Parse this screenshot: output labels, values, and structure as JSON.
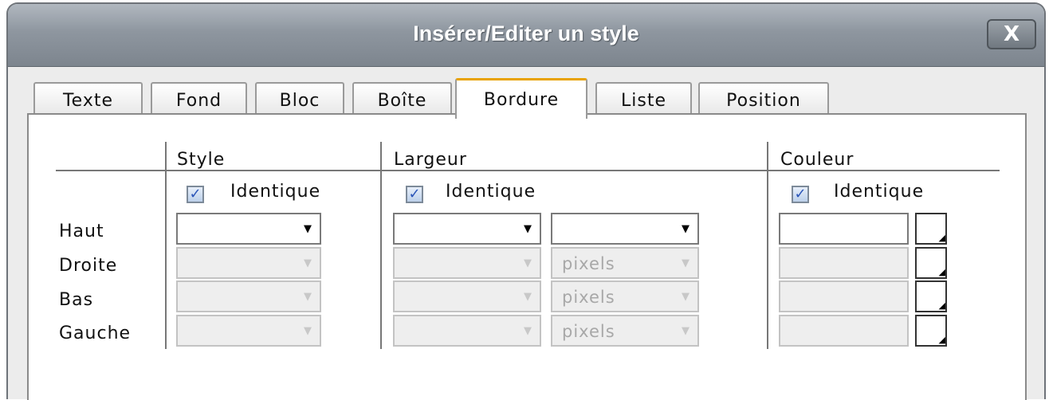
{
  "window": {
    "title": "Insérer/Editer un style",
    "close_label": "X"
  },
  "tabs": [
    {
      "label": "Texte"
    },
    {
      "label": "Fond"
    },
    {
      "label": "Bloc"
    },
    {
      "label": "Boîte"
    },
    {
      "label": "Bordure",
      "active": true
    },
    {
      "label": "Liste"
    },
    {
      "label": "Position"
    }
  ],
  "columns": {
    "style": "Style",
    "largeur": "Largeur",
    "couleur": "Couleur"
  },
  "identique": {
    "label": "Identique",
    "style_checked": true,
    "largeur_checked": true,
    "couleur_checked": true
  },
  "rows": [
    {
      "label": "Haut",
      "style": "",
      "width": "",
      "unit": "",
      "color": ""
    },
    {
      "label": "Droite",
      "style": "",
      "width": "",
      "unit": "pixels",
      "color": ""
    },
    {
      "label": "Bas",
      "style": "",
      "width": "",
      "unit": "pixels",
      "color": ""
    },
    {
      "label": "Gauche",
      "style": "",
      "width": "",
      "unit": "pixels",
      "color": ""
    }
  ],
  "icons": {
    "check": "check-icon",
    "dropdown": "chevron-down-icon",
    "color_picker": "color-picker-icon"
  },
  "colors": {
    "active_tab_accent": "#e8a200",
    "titlebar": "#8e969f",
    "checkbox_mark": "#2a55b8"
  }
}
